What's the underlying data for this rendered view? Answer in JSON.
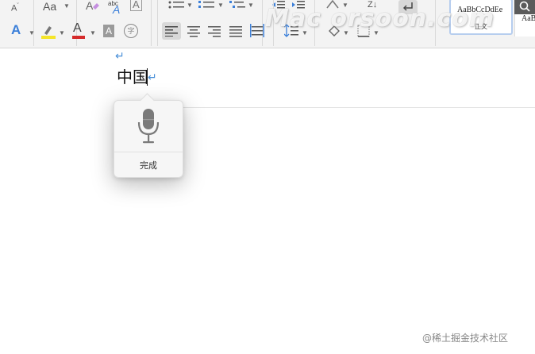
{
  "ribbon": {
    "font_size_label": "A",
    "change_case_label": "Aa",
    "phonetic_label": "abc",
    "char_border_label": "A",
    "text_effects_label": "A",
    "font_color_label": "A",
    "char_shading_label": "A",
    "enclose_label": "字",
    "sort_label": "Z",
    "styles": [
      {
        "name": "AaBbCcDdEe",
        "sub": "正文"
      },
      {
        "name": "AaB"
      }
    ],
    "colors": {
      "text_effects": "#3b7fd9",
      "highlight": "#f5e52a",
      "font_color": "#d52b2b"
    }
  },
  "watermark": "Mac orsoon.com",
  "document": {
    "text": "中国",
    "paragraph_mark": "↵"
  },
  "dictation": {
    "done_label": "完成"
  },
  "credit": "@稀土掘金技术社区"
}
